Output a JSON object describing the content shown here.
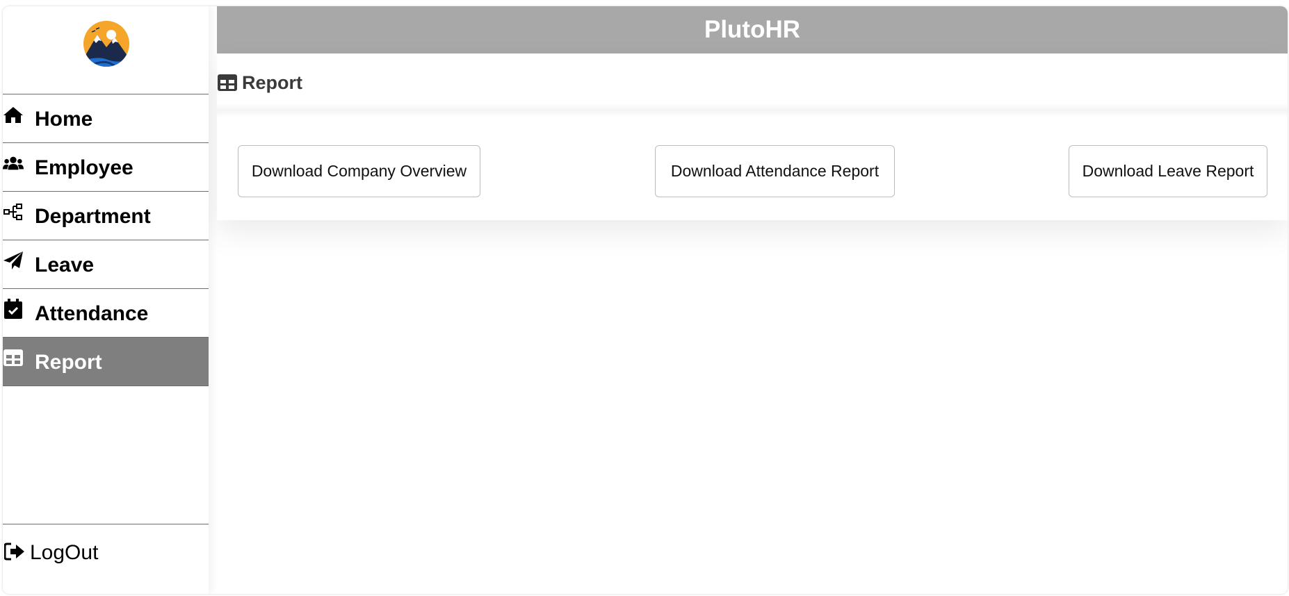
{
  "app": {
    "title": "PlutoHR"
  },
  "sidebar": {
    "logo_icon": "mountain-sun-logo",
    "items": [
      {
        "label": "Home",
        "icon": "home-icon",
        "active": false
      },
      {
        "label": "Employee",
        "icon": "users-icon",
        "active": false
      },
      {
        "label": "Department",
        "icon": "sitemap-icon",
        "active": false
      },
      {
        "label": "Leave",
        "icon": "paper-plane-icon",
        "active": false
      },
      {
        "label": "Attendance",
        "icon": "calendar-check-icon",
        "active": false
      },
      {
        "label": "Report",
        "icon": "table-icon",
        "active": true
      }
    ],
    "logout": {
      "label": "LogOut",
      "icon": "sign-out-icon"
    }
  },
  "main": {
    "section_title": "Report",
    "section_icon": "table-icon",
    "buttons": [
      {
        "label": "Download Company Overview"
      },
      {
        "label": "Download Attendance Report"
      },
      {
        "label": "Download Leave Report"
      }
    ]
  },
  "colors": {
    "header_bg": "#a9a8a8",
    "active_nav_bg": "#7f7f7f",
    "logo_orange": "#f4a52a",
    "logo_navy": "#1b2a4a",
    "logo_blue": "#1f6fd1"
  }
}
